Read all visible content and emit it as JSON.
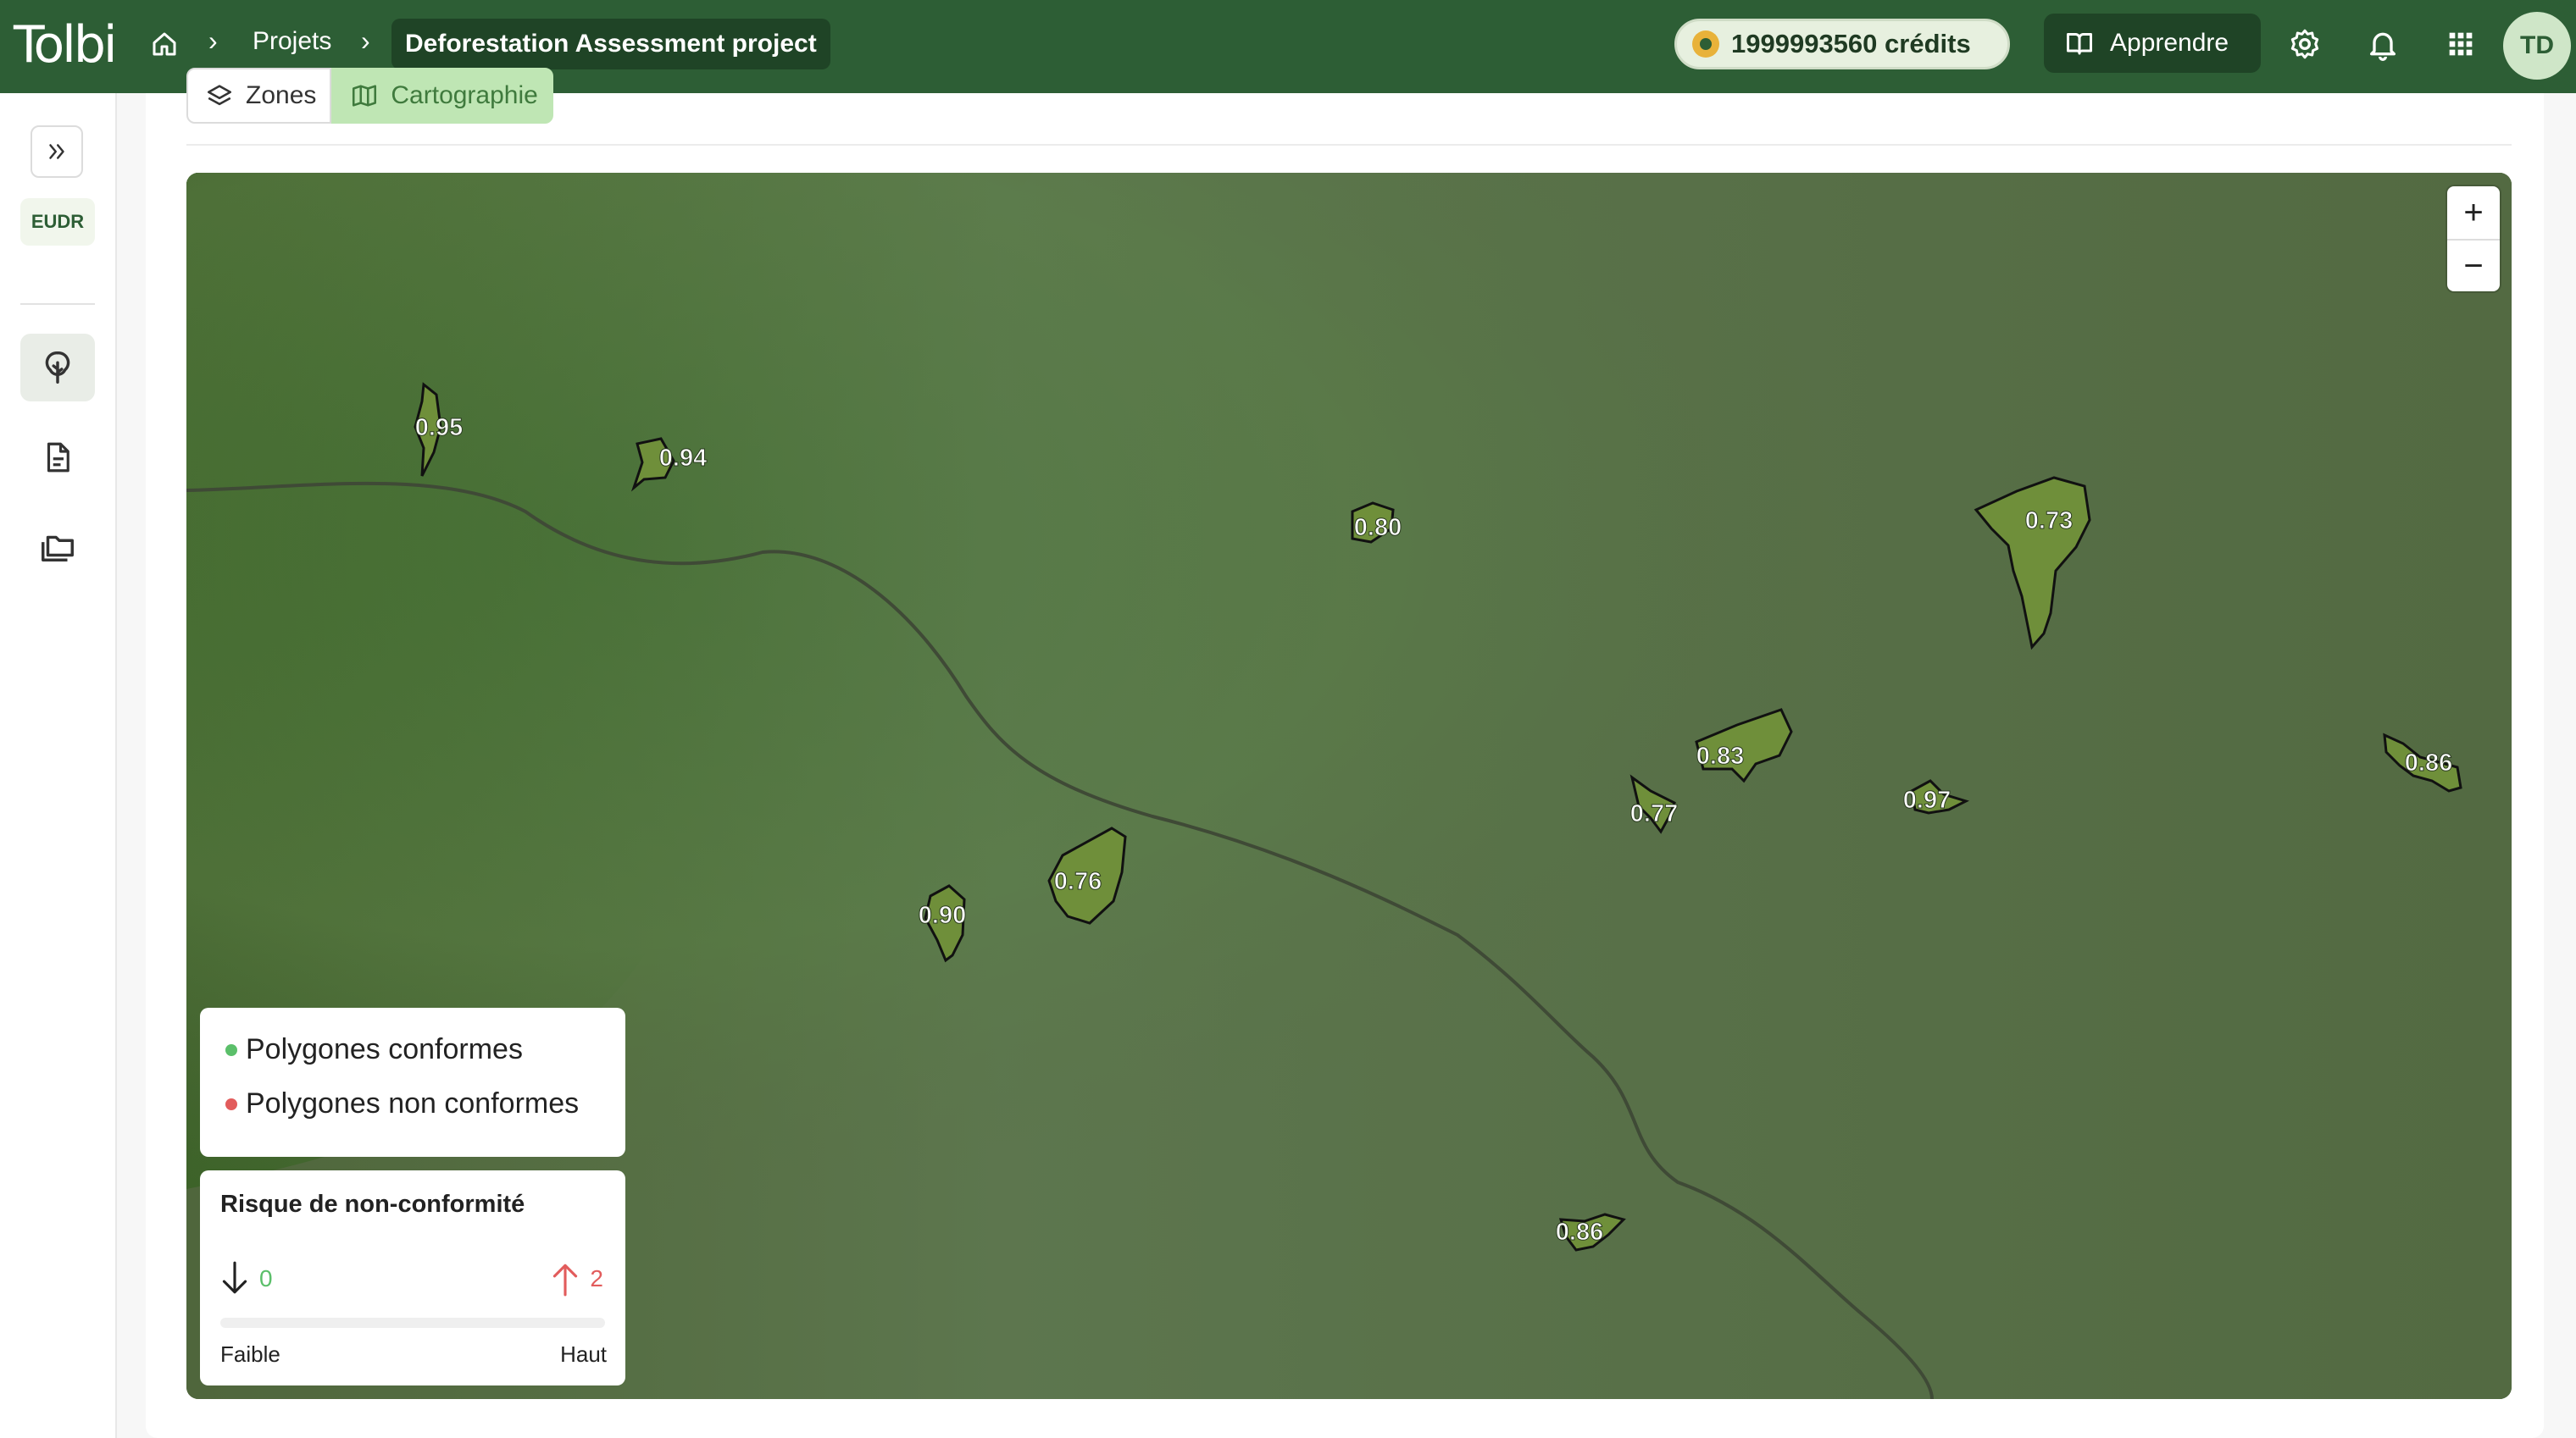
{
  "app": {
    "logo": "Tolbi"
  },
  "header": {
    "breadcrumb": [
      "Projets",
      "Deforestation Assessment project"
    ],
    "credits": "1999993560 crédits",
    "learn_label": "Apprendre",
    "avatar": "TD"
  },
  "sidebar": {
    "badge": "EUDR",
    "items": [
      {
        "icon": "tree-icon",
        "active": true
      },
      {
        "icon": "document-icon",
        "active": false
      },
      {
        "icon": "folders-icon",
        "active": false
      }
    ]
  },
  "tabs": [
    {
      "label": "Zones",
      "active": false
    },
    {
      "label": "Cartographie",
      "active": true
    }
  ],
  "map": {
    "polygons": [
      {
        "label": "0.95"
      },
      {
        "label": "0.94"
      },
      {
        "label": "0.80"
      },
      {
        "label": "0.73"
      },
      {
        "label": "0.83"
      },
      {
        "label": "0.77"
      },
      {
        "label": "0.97"
      },
      {
        "label": "0.86"
      },
      {
        "label": "0.76"
      },
      {
        "label": "0.90"
      },
      {
        "label": "0.86"
      }
    ],
    "zoom_in": "+",
    "zoom_out": "−"
  },
  "legend": {
    "items": [
      {
        "label": "Polygones conformes",
        "color": "#5bbf6a"
      },
      {
        "label": "Polygones non conformes",
        "color": "#e25c5c"
      }
    ]
  },
  "risk": {
    "title": "Risque de non-conformité",
    "low_value": "0",
    "high_value": "2",
    "low_label": "Faible",
    "high_label": "Haut"
  }
}
